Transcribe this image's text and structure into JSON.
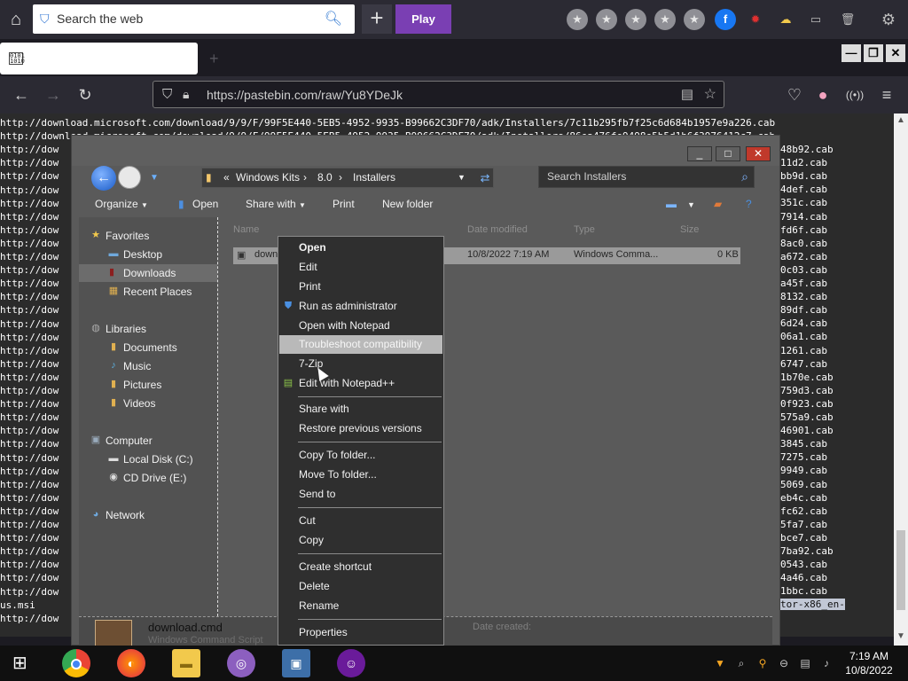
{
  "launcher": {
    "search_placeholder": "Search the web",
    "play_label": "Play",
    "icons": [
      "home-icon",
      "shield-icon",
      "search-icon",
      "plus-icon",
      "star-icon",
      "facebook-icon",
      "bug-icon",
      "weather-icon",
      "folder-icon",
      "trash-icon",
      "gear-icon"
    ]
  },
  "browser": {
    "url": "https://pastebin.com/raw/Yu8YDeJk",
    "tab_title": ""
  },
  "page_lines": [
    "http://download.microsoft.com/download/9/9/F/99F5E440-5EB5-4952-9935-B99662C3DF70/adk/Installers/7c11b295fb7f25c6d684b1957e9a226.cab",
    "http://download.microsoft.com/download/9/9/F/99F5E440-5EB5-4952-9935-B99662C3DF70/adk/Installers/86ea476fe9498e5b5d1b6f3976412c7.cab",
    "http://dow",
    "http://dow",
    "http://dow",
    "http://dow",
    "http://dow",
    "http://dow",
    "http://dow",
    "http://dow",
    "http://dow",
    "http://dow",
    "http://dow",
    "http://dow",
    "http://dow",
    "http://dow",
    "http://dow",
    "http://dow",
    "http://dow",
    "http://dow",
    "http://dow",
    "http://dow",
    "http://dow",
    "http://dow",
    "http://dow",
    "http://dow",
    "http://dow",
    "http://dow",
    "http://dow",
    "http://dow",
    "http://dow",
    "http://dow",
    "http://dow",
    "http://dow",
    "http://dow",
    "http://dow",
    "us.msi",
    "http://dow"
  ],
  "page_right_tails": [
    "48b92.cab",
    "11d2.cab",
    "bb9d.cab",
    "4def.cab",
    "351c.cab",
    "7914.cab",
    "fd6f.cab",
    "8ac0.cab",
    "a672.cab",
    "0c03.cab",
    "a45f.cab",
    "8132.cab",
    "89df.cab",
    "6d24.cab",
    "06a1.cab",
    "1261.cab",
    "6747.cab",
    "1b70e.cab",
    "759d3.cab",
    "0f923.cab",
    "575a9.cab",
    "46901.cab",
    "3845.cab",
    "7275.cab",
    "9949.cab",
    "5069.cab",
    "eb4c.cab",
    "fc62.cab",
    "5fa7.cab",
    "bce7.cab",
    "7ba92.cab",
    "0543.cab",
    "4a46.cab",
    "1bbc.cab",
    "tor-x86_en-"
  ],
  "explorer": {
    "breadcrumb": [
      "Windows Kits",
      "8.0",
      "Installers"
    ],
    "breadcrumb_prefix": "«",
    "search_placeholder": "Search Installers",
    "toolbar": {
      "organize": "Organize",
      "open": "Open",
      "share_with": "Share with",
      "print": "Print",
      "new_folder": "New folder"
    },
    "nav": {
      "favorites": "Favorites",
      "desktop": "Desktop",
      "downloads": "Downloads",
      "recent": "Recent Places",
      "libraries": "Libraries",
      "documents": "Documents",
      "music": "Music",
      "pictures": "Pictures",
      "videos": "Videos",
      "computer": "Computer",
      "local_disk": "Local Disk (C:)",
      "cd_drive": "CD Drive (E:)",
      "network": "Network"
    },
    "columns": [
      "Name",
      "Date modified",
      "Type",
      "Size"
    ],
    "file": {
      "name": "down",
      "date": "10/8/2022 7:19 AM",
      "type": "Windows Comma...",
      "size": "0 KB"
    },
    "details": {
      "filename": "download.cmd",
      "filetype": "Windows Command Script",
      "date_created_label": "Date created:"
    }
  },
  "context_menu": {
    "open": "Open",
    "edit": "Edit",
    "print": "Print",
    "run_admin": "Run as administrator",
    "open_notepad": "Open with Notepad",
    "troubleshoot": "Troubleshoot compatibility",
    "seven_zip": "7-Zip",
    "edit_npp": "Edit with Notepad++",
    "share_with": "Share with",
    "restore": "Restore previous versions",
    "copy_to": "Copy To folder...",
    "move_to": "Move To folder...",
    "send_to": "Send to",
    "cut": "Cut",
    "copy": "Copy",
    "create_shortcut": "Create shortcut",
    "delete": "Delete",
    "rename": "Rename",
    "properties": "Properties"
  },
  "taskbar": {
    "time": "7:19 AM",
    "date": "10/8/2022"
  }
}
